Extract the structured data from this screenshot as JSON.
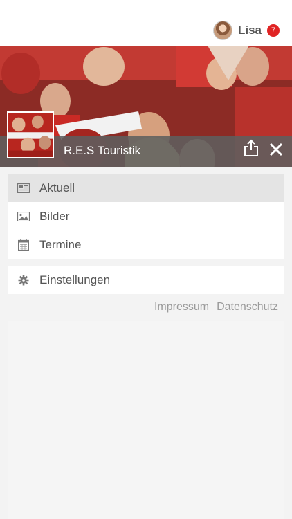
{
  "user": {
    "name": "Lisa",
    "notification_count": "7"
  },
  "header": {
    "org_name": "R.E.S Touristik"
  },
  "menu": {
    "items": [
      {
        "label": "Aktuell",
        "icon": "newspaper-icon",
        "active": true
      },
      {
        "label": "Bilder",
        "icon": "image-icon",
        "active": false
      },
      {
        "label": "Termine",
        "icon": "calendar-icon",
        "active": false
      }
    ],
    "settings_label": "Einstellungen"
  },
  "footer": {
    "impressum": "Impressum",
    "datenschutz": "Datenschutz"
  },
  "colors": {
    "accent": "#e02424",
    "active_bg": "#e4e4e4",
    "bar_bg": "#5f5f5f"
  }
}
